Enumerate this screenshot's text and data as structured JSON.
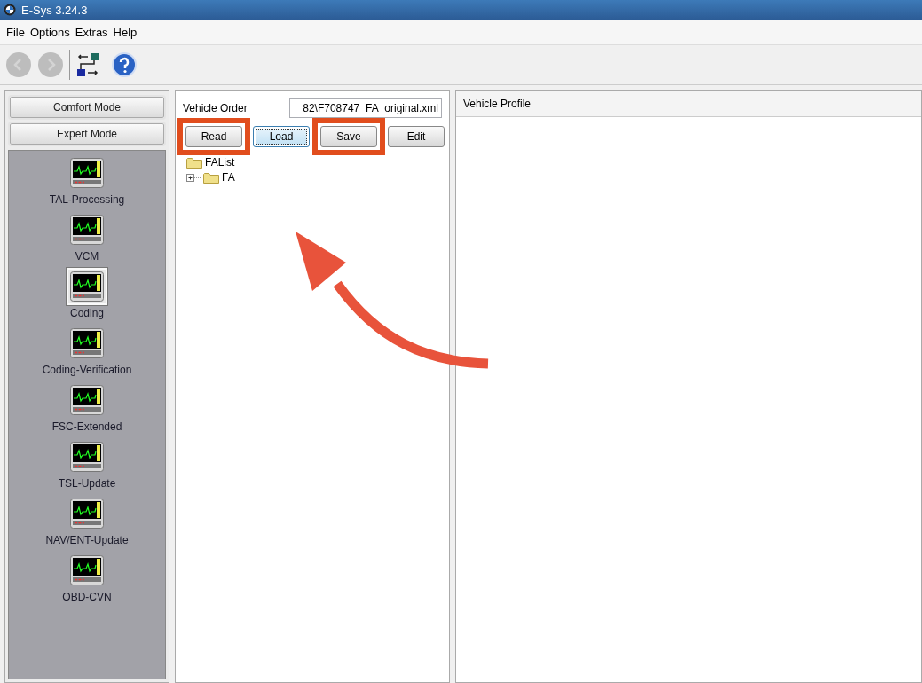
{
  "window": {
    "title": "E-Sys 3.24.3"
  },
  "menu": [
    "File",
    "Options",
    "Extras",
    "Help"
  ],
  "sidebar": {
    "modes": [
      "Comfort Mode",
      "Expert Mode"
    ],
    "items": [
      {
        "label": "TAL-Processing",
        "selected": false
      },
      {
        "label": "VCM",
        "selected": false
      },
      {
        "label": "Coding",
        "selected": true
      },
      {
        "label": "Coding-Verification",
        "selected": false
      },
      {
        "label": "FSC-Extended",
        "selected": false
      },
      {
        "label": "TSL-Update",
        "selected": false
      },
      {
        "label": "NAV/ENT-Update",
        "selected": false
      },
      {
        "label": "OBD-CVN",
        "selected": false
      }
    ]
  },
  "vehicle_order": {
    "label": "Vehicle Order",
    "value": "82\\F708747_FA_original.xml",
    "buttons": [
      {
        "label": "Read",
        "highlighted": true,
        "focused": false
      },
      {
        "label": "Load",
        "highlighted": false,
        "focused": true
      },
      {
        "label": "Save",
        "highlighted": true,
        "focused": false
      },
      {
        "label": "Edit",
        "highlighted": false,
        "focused": false
      }
    ],
    "tree": [
      {
        "label": "FAList",
        "children": [
          {
            "label": "FA",
            "expanded": false
          }
        ]
      }
    ]
  },
  "profile": {
    "title": "Vehicle Profile"
  }
}
